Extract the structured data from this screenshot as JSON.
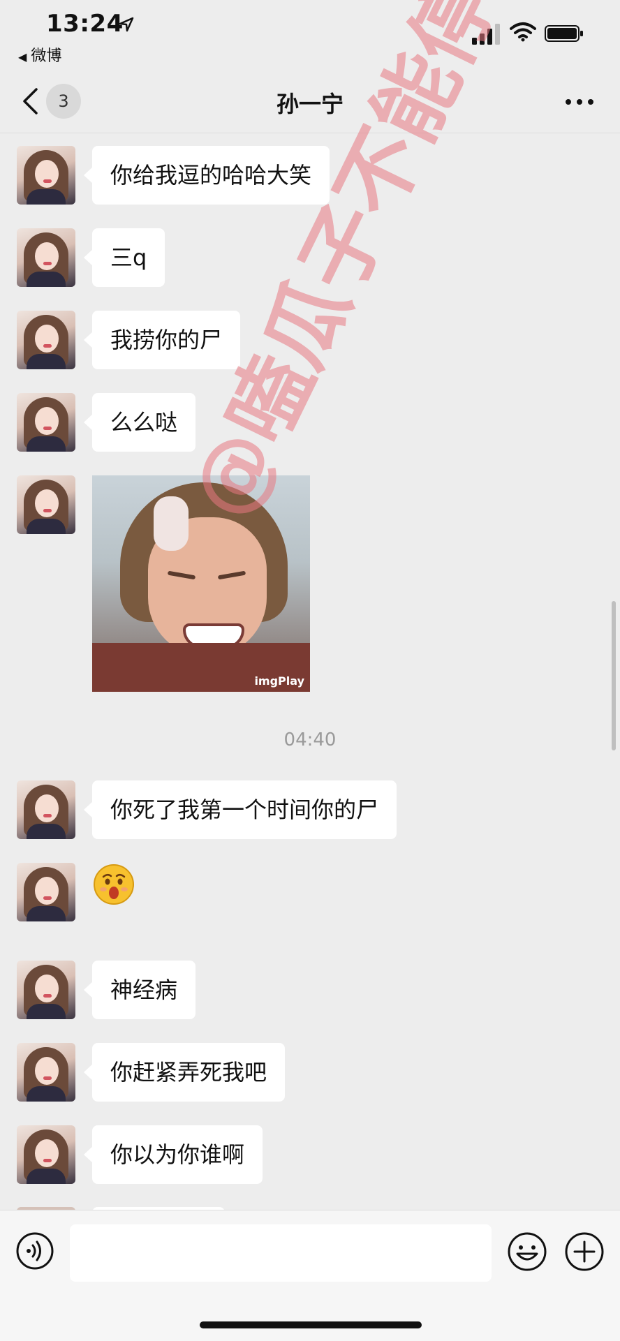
{
  "status_bar": {
    "time": "13:24",
    "back_app": "微博"
  },
  "nav": {
    "unread_count": "3",
    "title": "孙一宁"
  },
  "messages": [
    {
      "type": "text",
      "text": "你给我逗的哈哈大笑"
    },
    {
      "type": "text",
      "text": "三q"
    },
    {
      "type": "text",
      "text": "我捞你的尸"
    },
    {
      "type": "text",
      "text": "么么哒"
    },
    {
      "type": "image",
      "image_text": "imgPlay"
    },
    {
      "type": "time",
      "text": "04:40"
    },
    {
      "type": "text",
      "text": "你死了我第一个时间你的尸"
    },
    {
      "type": "emoji",
      "emoji": "😲"
    },
    {
      "type": "text",
      "text": "神经病"
    },
    {
      "type": "text",
      "text": "你赶紧弄死我吧"
    },
    {
      "type": "text",
      "text": "你以为你谁啊"
    }
  ],
  "watermark": "@嗑瓜子不能停",
  "colors": {
    "background": "#ededed",
    "bubble": "#ffffff",
    "watermark": "#e87882"
  }
}
